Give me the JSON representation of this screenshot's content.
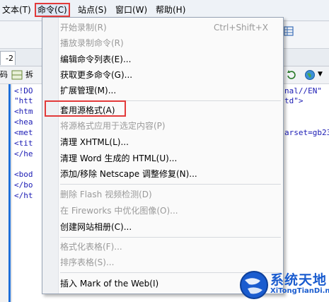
{
  "menubar": {
    "items": [
      {
        "label": "文本(T)"
      },
      {
        "label": "命令(C)"
      },
      {
        "label": "站点(S)"
      },
      {
        "label": "窗口(W)"
      },
      {
        "label": "帮助(H)"
      }
    ],
    "highlight_color": "#e23a3a"
  },
  "document": {
    "tab_label": "-2",
    "view_buttons": [
      "码",
      "拆"
    ],
    "code_lines": [
      "<!DO",
      "\"htt",
      "<htm",
      "<hea",
      "<met",
      "<tit",
      "</he",
      "",
      "<bod",
      "</bo",
      "</ht"
    ],
    "code_right": [
      "nal//EN\"",
      "td\">",
      "arset=gb23"
    ]
  },
  "dropdown": {
    "items": [
      {
        "label": "开始录制(R)",
        "shortcut": "Ctrl+Shift+X",
        "disabled": true
      },
      {
        "label": "播放录制命令(R)",
        "shortcut": "",
        "disabled": true
      },
      {
        "label": "编辑命令列表(E)...",
        "shortcut": "",
        "disabled": false
      },
      {
        "label": "获取更多命令(G)...",
        "shortcut": "",
        "disabled": false
      },
      {
        "label": "扩展管理(M)...",
        "shortcut": "",
        "disabled": false
      },
      {
        "label": "套用源格式(A)",
        "shortcut": "",
        "disabled": false,
        "highlighted": true
      },
      {
        "label": "将源格式应用于选定内容(P)",
        "shortcut": "",
        "disabled": true
      },
      {
        "label": "清理 XHTML(L)...",
        "shortcut": "",
        "disabled": false
      },
      {
        "label": "清理 Word 生成的 HTML(U)...",
        "shortcut": "",
        "disabled": false
      },
      {
        "label": "添加/移除 Netscape 调整修复(N)...",
        "shortcut": "",
        "disabled": false
      },
      {
        "label": "删除 Flash 视频检测(D)",
        "shortcut": "",
        "disabled": true
      },
      {
        "label": "在 Fireworks 中优化图像(O)...",
        "shortcut": "",
        "disabled": true
      },
      {
        "label": "创建网站相册(C)...",
        "shortcut": "",
        "disabled": false
      },
      {
        "label": "格式化表格(F)...",
        "shortcut": "",
        "disabled": true
      },
      {
        "label": "排序表格(S)...",
        "shortcut": "",
        "disabled": true
      },
      {
        "label": "插入 Mark of the Web(I)",
        "shortcut": "",
        "disabled": false
      }
    ]
  },
  "watermark": {
    "title": "系统天地",
    "subtitle": "XiTongTianDi.net",
    "color": "#1a5ccf"
  }
}
